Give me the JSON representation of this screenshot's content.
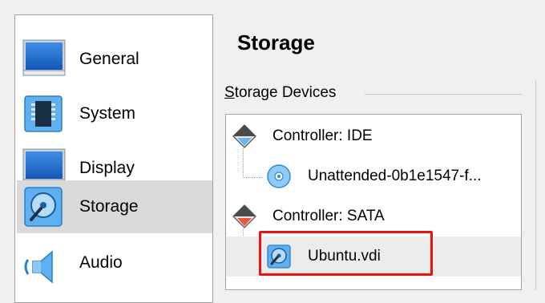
{
  "sidebar": {
    "items": [
      {
        "label": "General",
        "icon": "monitor-icon",
        "selected": false
      },
      {
        "label": "System",
        "icon": "chip-icon",
        "selected": false
      },
      {
        "label": "Display",
        "icon": "monitor-icon",
        "selected": false
      },
      {
        "label": "Storage",
        "icon": "disk-icon",
        "selected": true
      },
      {
        "label": "Audio",
        "icon": "speaker-icon",
        "selected": false
      }
    ]
  },
  "main": {
    "title": "Storage",
    "group": {
      "mnemonic": "S",
      "rest": "torage Devices"
    },
    "tree": [
      {
        "label": "Controller: IDE",
        "icon": "ide-controller-icon"
      },
      {
        "label": "Unattended-0b1e1547-f...",
        "icon": "optical-disc-icon"
      },
      {
        "label": "Controller: SATA",
        "icon": "sata-controller-icon"
      },
      {
        "label": "Ubuntu.vdi",
        "icon": "hard-disk-icon",
        "selected": true
      }
    ]
  },
  "colors": {
    "accent": "#1f7fd6",
    "highlight": "#ee1111",
    "selection": "#d9d9d9"
  }
}
